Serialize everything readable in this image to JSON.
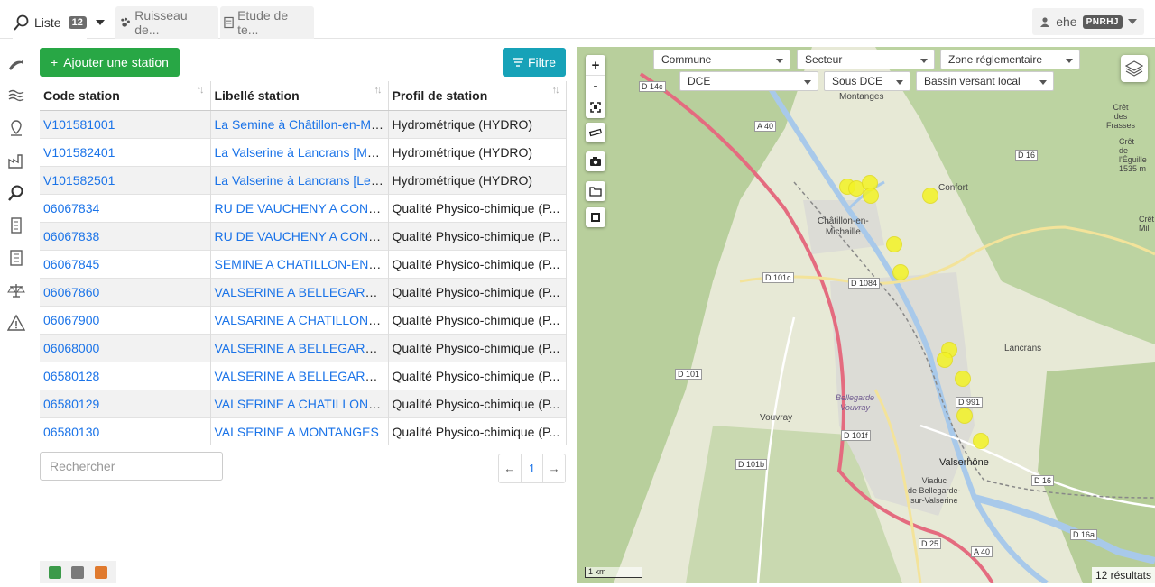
{
  "tabs": [
    {
      "label": "Liste",
      "count": "12"
    },
    {
      "label": "Ruisseau de..."
    },
    {
      "label": "Etude de te..."
    }
  ],
  "user": {
    "name": "ehe",
    "org": "PNRHJ"
  },
  "toolbar": {
    "add_label": "Ajouter une station",
    "filter_label": "Filtre"
  },
  "table": {
    "headers": [
      "Code station",
      "Libellé station",
      "Profil de station"
    ],
    "rows": [
      [
        "V101581001",
        "La Semine à Châtillon-en-Michaille",
        "Hydrométrique (HYDRO)"
      ],
      [
        "V101582401",
        "La Valserine à Lancrans [Mo...",
        "Hydrométrique (HYDRO)"
      ],
      [
        "V101582501",
        "La Valserine à Lancrans [Le ...",
        "Hydrométrique (HYDRO)"
      ],
      [
        "06067834",
        "RU DE VAUCHENY A CONFORT",
        "Qualité Physico-chimique (P..."
      ],
      [
        "06067838",
        "RU DE VAUCHENY A CONFORT",
        "Qualité Physico-chimique (P..."
      ],
      [
        "06067845",
        "SEMINE A CHATILLON-EN-MICHAILLE",
        "Qualité Physico-chimique (P..."
      ],
      [
        "06067860",
        "VALSERINE A BELLEGARDE-SUR-VALSERINE",
        "Qualité Physico-chimique (P..."
      ],
      [
        "06067900",
        "VALSARINE A CHATILLON-EN-MICHAILLE",
        "Qualité Physico-chimique (P..."
      ],
      [
        "06068000",
        "VALSERINE A BELLEGARDE-SUR-VALSERINE",
        "Qualité Physico-chimique (P..."
      ],
      [
        "06580128",
        "VALSERINE A BELLEGARDE-SUR-VALSERINE",
        "Qualité Physico-chimique (P..."
      ],
      [
        "06580129",
        "VALSERINE A CHATILLON-EN-MICHAILLE",
        "Qualité Physico-chimique (P..."
      ],
      [
        "06580130",
        "VALSERINE A MONTANGES",
        "Qualité Physico-chimique (P..."
      ]
    ]
  },
  "search": {
    "placeholder": "Rechercher"
  },
  "pager": {
    "prev": "←",
    "current": "1",
    "next": "→"
  },
  "map": {
    "filters": {
      "commune": "Commune",
      "secteur": "Secteur",
      "zone": "Zone réglementaire",
      "dce": "DCE",
      "sous_dce": "Sous DCE",
      "bassin": "Bassin versant local"
    },
    "scale": "1 km",
    "results": "12 résultats",
    "places": {
      "montanges": "Montanges",
      "chatillon": "Châtillon-en-\nMichaille",
      "confort": "Confort",
      "lancrans": "Lancrans",
      "vouvray": "Vouvray",
      "valserhone": "Valserhône",
      "viaduc": "Viaduc\nde Bellegarde-\nsur-Valserine",
      "bellegarde": "Bellegarde\nVouvray",
      "cret_frasses": "Crêt\ndes\nFrasses",
      "cret_eguille": "Crêt\nde l'Éguille\n1535 m",
      "cret": "Crêt\nMil"
    },
    "roads": [
      "D 14c",
      "A 40",
      "D 16",
      "D 101c",
      "D 1084",
      "D 101",
      "D 991",
      "D 101f",
      "D 101b",
      "D 16",
      "D 25",
      "D 16a",
      "A 40"
    ],
    "colors": {
      "marker": "#f3f325",
      "motorway": "#e46b7f",
      "primary": "#f3e39a",
      "water": "#a8c9ea",
      "forest": "#b8cf9c"
    }
  },
  "colors": {
    "add_button": "#28a745",
    "filter_button": "#17a2b8",
    "link": "#1a73e8"
  }
}
